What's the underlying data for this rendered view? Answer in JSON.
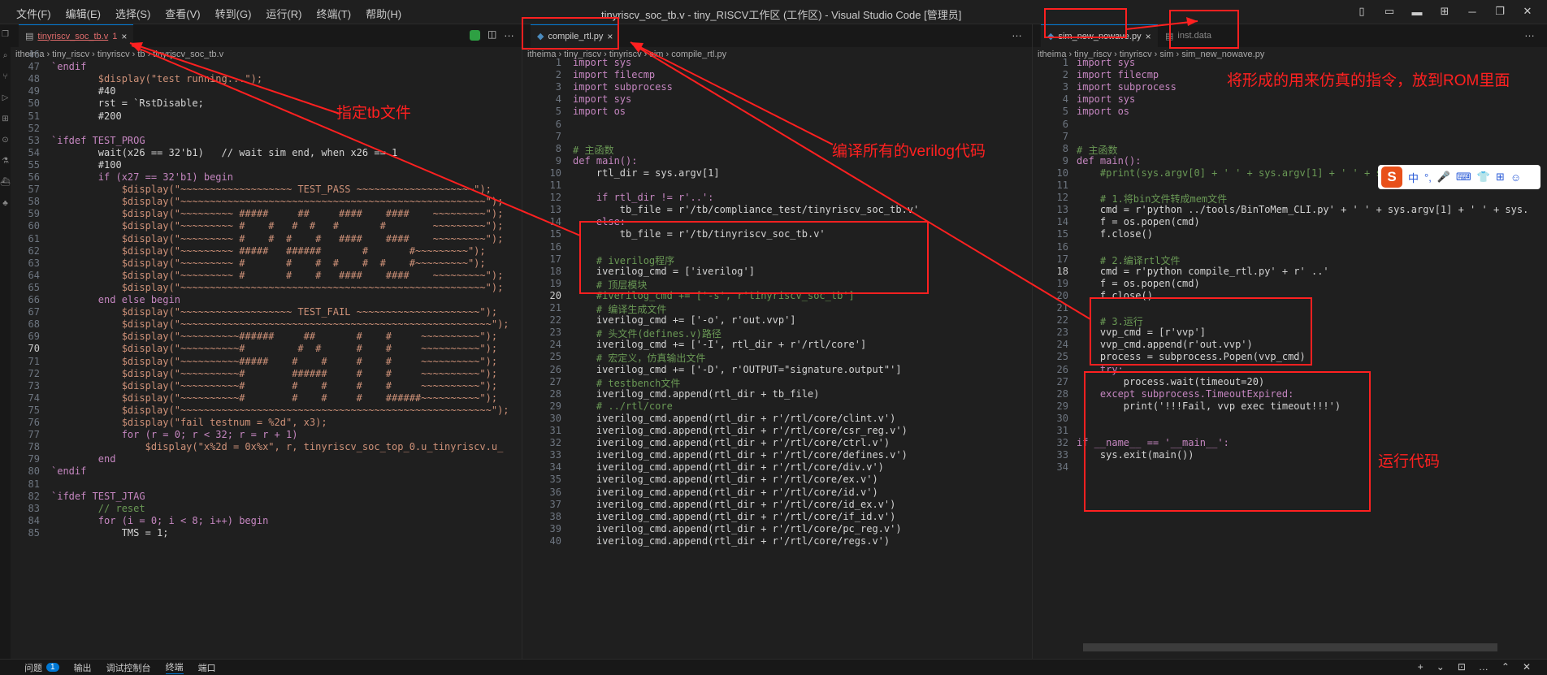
{
  "window": {
    "title": "tinyriscv_soc_tb.v - tiny_RISCV工作区 (工作区) - Visual Studio Code [管理员]"
  },
  "menu": [
    "文件(F)",
    "编辑(E)",
    "选择(S)",
    "查看(V)",
    "转到(G)",
    "运行(R)",
    "终端(T)",
    "帮助(H)"
  ],
  "winctrl": [
    "▯",
    "▭",
    "▬",
    "⊞",
    "─",
    "❐",
    "✕"
  ],
  "activity_icons": [
    "files-icon",
    "search-icon",
    "source-control-icon",
    "run-debug-icon",
    "extensions-icon",
    "remote-icon",
    "testing-icon",
    "docker-icon",
    "python-icon"
  ],
  "pane1": {
    "tab": "tinyriscv_soc_tb.v",
    "tab_mod": "1",
    "close": "×",
    "breadcrumb": "itheima  ›  tiny_riscv  ›  tinyriscv  ›  tb  ›  tinyriscv_soc_tb.v",
    "lines": [
      {
        "n": "46",
        "t": "                    ,"
      },
      {
        "n": "47",
        "t": "`endif",
        "c": "#c586c0"
      },
      {
        "n": "48",
        "t": "        $display(\"test running...\");"
      },
      {
        "n": "49",
        "t": "        #40"
      },
      {
        "n": "50",
        "t": "        rst = `RstDisable;"
      },
      {
        "n": "51",
        "t": "        #200"
      },
      {
        "n": "52",
        "t": ""
      },
      {
        "n": "53",
        "t": "`ifdef TEST_PROG"
      },
      {
        "n": "54",
        "t": "        wait(x26 == 32'b1)   // wait sim end, when x26 == 1"
      },
      {
        "n": "55",
        "t": "        #100"
      },
      {
        "n": "56",
        "t": "        if (x27 == 32'b1) begin"
      },
      {
        "n": "57",
        "t": "            $display(\"~~~~~~~~~~~~~~~~~~~ TEST_PASS ~~~~~~~~~~~~~~~~~~~~\");"
      },
      {
        "n": "58",
        "t": "            $display(\"~~~~~~~~~~~~~~~~~~~~~~~~~~~~~~~~~~~~~~~~~~~~~~~~~~~~\");"
      },
      {
        "n": "59",
        "t": "            $display(\"~~~~~~~~~ #####     ##     ####    ####    ~~~~~~~~~\");"
      },
      {
        "n": "60",
        "t": "            $display(\"~~~~~~~~~ #    #   #  #   #       #        ~~~~~~~~~\");"
      },
      {
        "n": "61",
        "t": "            $display(\"~~~~~~~~~ #    #  #    #   ####    ####    ~~~~~~~~~\");"
      },
      {
        "n": "62",
        "t": "            $display(\"~~~~~~~~~ #####   ######       #       #~~~~~~~~~\");"
      },
      {
        "n": "63",
        "t": "            $display(\"~~~~~~~~~ #       #    #  #    #  #    #~~~~~~~~~\");"
      },
      {
        "n": "64",
        "t": "            $display(\"~~~~~~~~~ #       #    #   ####    ####    ~~~~~~~~~\");"
      },
      {
        "n": "65",
        "t": "            $display(\"~~~~~~~~~~~~~~~~~~~~~~~~~~~~~~~~~~~~~~~~~~~~~~~~~~~~\");"
      },
      {
        "n": "66",
        "t": "        end else begin"
      },
      {
        "n": "67",
        "t": "            $display(\"~~~~~~~~~~~~~~~~~~~ TEST_FAIL ~~~~~~~~~~~~~~~~~~~~~\");"
      },
      {
        "n": "68",
        "t": "            $display(\"~~~~~~~~~~~~~~~~~~~~~~~~~~~~~~~~~~~~~~~~~~~~~~~~~~~~~\");"
      },
      {
        "n": "69",
        "t": "            $display(\"~~~~~~~~~~######     ##       #    #     ~~~~~~~~~~\");"
      },
      {
        "n": "70",
        "t": "            $display(\"~~~~~~~~~~#         #  #      #    #     ~~~~~~~~~~\");"
      },
      {
        "n": "71",
        "t": "            $display(\"~~~~~~~~~~#####    #    #     #    #     ~~~~~~~~~~\");"
      },
      {
        "n": "72",
        "t": "            $display(\"~~~~~~~~~~#        ######     #    #     ~~~~~~~~~~\");"
      },
      {
        "n": "73",
        "t": "            $display(\"~~~~~~~~~~#        #    #     #    #     ~~~~~~~~~~\");"
      },
      {
        "n": "74",
        "t": "            $display(\"~~~~~~~~~~#        #    #     #    ######~~~~~~~~~~\");"
      },
      {
        "n": "75",
        "t": "            $display(\"~~~~~~~~~~~~~~~~~~~~~~~~~~~~~~~~~~~~~~~~~~~~~~~~~~~~~\");"
      },
      {
        "n": "76",
        "t": "            $display(\"fail testnum = %2d\", x3);"
      },
      {
        "n": "77",
        "t": "            for (r = 0; r < 32; r = r + 1)"
      },
      {
        "n": "78",
        "t": "                $display(\"x%2d = 0x%x\", r, tinyriscv_soc_top_0.u_tinyriscv.u_"
      },
      {
        "n": "79",
        "t": "        end"
      },
      {
        "n": "80",
        "t": "`endif"
      },
      {
        "n": "81",
        "t": ""
      },
      {
        "n": "82",
        "t": "`ifdef TEST_JTAG"
      },
      {
        "n": "83",
        "t": "        // reset"
      },
      {
        "n": "84",
        "t": "        for (i = 0; i < 8; i++) begin"
      },
      {
        "n": "85",
        "t": "            TMS = 1;"
      }
    ]
  },
  "pane2": {
    "tab": "compile_rtl.py",
    "close": "×",
    "breadcrumb": "itheima  ›  tiny_riscv  ›  tinyriscv  ›  sim  ›  compile_rtl.py",
    "lines": [
      {
        "n": "1",
        "t": "import sys"
      },
      {
        "n": "2",
        "t": "import filecmp"
      },
      {
        "n": "3",
        "t": "import subprocess"
      },
      {
        "n": "4",
        "t": "import sys"
      },
      {
        "n": "5",
        "t": "import os"
      },
      {
        "n": "6",
        "t": ""
      },
      {
        "n": "7",
        "t": ""
      },
      {
        "n": "8",
        "t": "# 主函数"
      },
      {
        "n": "9",
        "t": "def main():"
      },
      {
        "n": "10",
        "t": "    rtl_dir = sys.argv[1]"
      },
      {
        "n": "11",
        "t": ""
      },
      {
        "n": "12",
        "t": "    if rtl_dir != r'..':"
      },
      {
        "n": "13",
        "t": "        tb_file = r'/tb/compliance_test/tinyriscv_soc_tb.v'"
      },
      {
        "n": "14",
        "t": "    else:"
      },
      {
        "n": "15",
        "t": "        tb_file = r'/tb/tinyriscv_soc_tb.v'"
      },
      {
        "n": "16",
        "t": ""
      },
      {
        "n": "17",
        "t": "    # iverilog程序"
      },
      {
        "n": "18",
        "t": "    iverilog_cmd = ['iverilog']"
      },
      {
        "n": "19",
        "t": "    # 顶层模块"
      },
      {
        "n": "20",
        "t": "    #iverilog_cmd += ['-s', r'tinyriscv_soc_tb']"
      },
      {
        "n": "21",
        "t": "    # 编译生成文件"
      },
      {
        "n": "22",
        "t": "    iverilog_cmd += ['-o', r'out.vvp']"
      },
      {
        "n": "23",
        "t": "    # 头文件(defines.v)路径"
      },
      {
        "n": "24",
        "t": "    iverilog_cmd += ['-I', rtl_dir + r'/rtl/core']"
      },
      {
        "n": "25",
        "t": "    # 宏定义，仿真输出文件"
      },
      {
        "n": "26",
        "t": "    iverilog_cmd += ['-D', r'OUTPUT=\"signature.output\"']"
      },
      {
        "n": "27",
        "t": "    # testbench文件"
      },
      {
        "n": "28",
        "t": "    iverilog_cmd.append(rtl_dir + tb_file)"
      },
      {
        "n": "29",
        "t": "    # ../rtl/core"
      },
      {
        "n": "30",
        "t": "    iverilog_cmd.append(rtl_dir + r'/rtl/core/clint.v')"
      },
      {
        "n": "31",
        "t": "    iverilog_cmd.append(rtl_dir + r'/rtl/core/csr_reg.v')"
      },
      {
        "n": "32",
        "t": "    iverilog_cmd.append(rtl_dir + r'/rtl/core/ctrl.v')"
      },
      {
        "n": "33",
        "t": "    iverilog_cmd.append(rtl_dir + r'/rtl/core/defines.v')"
      },
      {
        "n": "34",
        "t": "    iverilog_cmd.append(rtl_dir + r'/rtl/core/div.v')"
      },
      {
        "n": "35",
        "t": "    iverilog_cmd.append(rtl_dir + r'/rtl/core/ex.v')"
      },
      {
        "n": "36",
        "t": "    iverilog_cmd.append(rtl_dir + r'/rtl/core/id.v')"
      },
      {
        "n": "37",
        "t": "    iverilog_cmd.append(rtl_dir + r'/rtl/core/id_ex.v')"
      },
      {
        "n": "38",
        "t": "    iverilog_cmd.append(rtl_dir + r'/rtl/core/if_id.v')"
      },
      {
        "n": "39",
        "t": "    iverilog_cmd.append(rtl_dir + r'/rtl/core/pc_reg.v')"
      },
      {
        "n": "40",
        "t": "    iverilog_cmd.append(rtl_dir + r'/rtl/core/regs.v')"
      }
    ]
  },
  "pane3": {
    "tab": "sim_new_nowave.py",
    "tab2": "inst.data",
    "close": "×",
    "breadcrumb": "itheima  ›  tiny_riscv  ›  tinyriscv  ›  sim  ›  sim_new_nowave.py",
    "lines": [
      {
        "n": "1",
        "t": "import sys"
      },
      {
        "n": "2",
        "t": "import filecmp"
      },
      {
        "n": "3",
        "t": "import subprocess"
      },
      {
        "n": "4",
        "t": "import sys"
      },
      {
        "n": "5",
        "t": "import os"
      },
      {
        "n": "6",
        "t": ""
      },
      {
        "n": "7",
        "t": ""
      },
      {
        "n": "8",
        "t": "# 主函数"
      },
      {
        "n": "9",
        "t": "def main():"
      },
      {
        "n": "10",
        "t": "    #print(sys.argv[0] + ' ' + sys.argv[1] + ' ' + sys.argv[2])"
      },
      {
        "n": "11",
        "t": ""
      },
      {
        "n": "12",
        "t": "    # 1.将bin文件转成mem文件"
      },
      {
        "n": "13",
        "t": "    cmd = r'python ../tools/BinToMem_CLI.py' + ' ' + sys.argv[1] + ' ' + sys."
      },
      {
        "n": "14",
        "t": "    f = os.popen(cmd)"
      },
      {
        "n": "15",
        "t": "    f.close()"
      },
      {
        "n": "16",
        "t": ""
      },
      {
        "n": "17",
        "t": "    # 2.编译rtl文件"
      },
      {
        "n": "18",
        "t": "    cmd = r'python compile_rtl.py' + r' ..'"
      },
      {
        "n": "19",
        "t": "    f = os.popen(cmd)"
      },
      {
        "n": "20",
        "t": "    f.close()"
      },
      {
        "n": "21",
        "t": ""
      },
      {
        "n": "22",
        "t": "    # 3.运行"
      },
      {
        "n": "23",
        "t": "    vvp_cmd = [r'vvp']"
      },
      {
        "n": "24",
        "t": "    vvp_cmd.append(r'out.vvp')"
      },
      {
        "n": "25",
        "t": "    process = subprocess.Popen(vvp_cmd)"
      },
      {
        "n": "26",
        "t": "    try:"
      },
      {
        "n": "27",
        "t": "        process.wait(timeout=20)"
      },
      {
        "n": "28",
        "t": "    except subprocess.TimeoutExpired:"
      },
      {
        "n": "29",
        "t": "        print('!!!Fail, vvp exec timeout!!!')"
      },
      {
        "n": "30",
        "t": ""
      },
      {
        "n": "31",
        "t": ""
      },
      {
        "n": "32",
        "t": "if __name__ == '__main__':"
      },
      {
        "n": "33",
        "t": "    sys.exit(main())"
      },
      {
        "n": "34",
        "t": ""
      }
    ]
  },
  "annotations": {
    "tb": "指定tb文件",
    "compile": "编译所有的verilog代码",
    "rom": "将形成的用来仿真的指令，放到ROM里面",
    "run": "运行代码"
  },
  "ime": {
    "logo": "S",
    "items": [
      "中",
      "°,",
      "🎤",
      "⌨",
      "👕",
      "⊞",
      "☺"
    ]
  },
  "status": {
    "problems": "问题",
    "problems_count": "1",
    "output": "输出",
    "debug_console": "调试控制台",
    "terminal": "终端",
    "ports": "端口",
    "right": [
      "+",
      "⌄",
      "⊡",
      "…",
      "⌃",
      "✕"
    ]
  },
  "colors": {
    "accent": "#0078d4",
    "annotation": "#ff2020"
  }
}
